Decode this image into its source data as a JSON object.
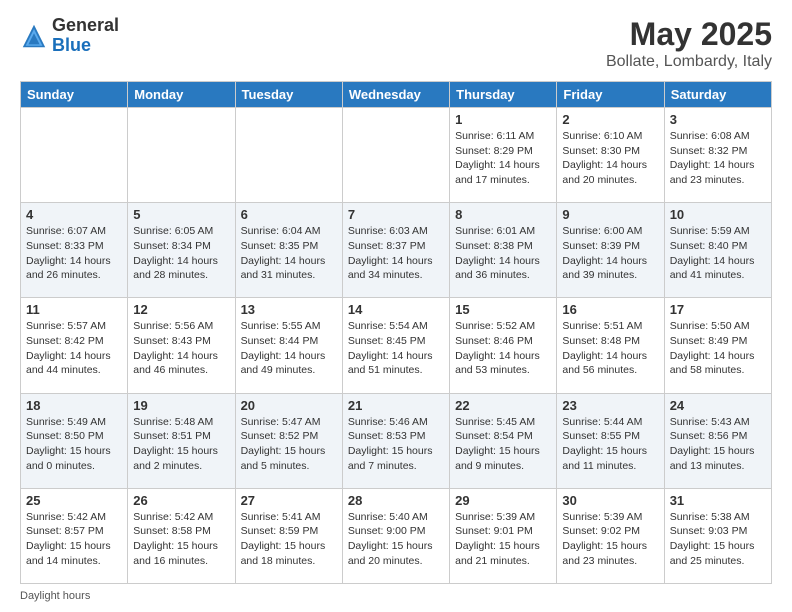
{
  "header": {
    "logo_general": "General",
    "logo_blue": "Blue",
    "month": "May 2025",
    "location": "Bollate, Lombardy, Italy"
  },
  "days_of_week": [
    "Sunday",
    "Monday",
    "Tuesday",
    "Wednesday",
    "Thursday",
    "Friday",
    "Saturday"
  ],
  "weeks": [
    [
      {
        "num": "",
        "info": ""
      },
      {
        "num": "",
        "info": ""
      },
      {
        "num": "",
        "info": ""
      },
      {
        "num": "",
        "info": ""
      },
      {
        "num": "1",
        "info": "Sunrise: 6:11 AM\nSunset: 8:29 PM\nDaylight: 14 hours and 17 minutes."
      },
      {
        "num": "2",
        "info": "Sunrise: 6:10 AM\nSunset: 8:30 PM\nDaylight: 14 hours and 20 minutes."
      },
      {
        "num": "3",
        "info": "Sunrise: 6:08 AM\nSunset: 8:32 PM\nDaylight: 14 hours and 23 minutes."
      }
    ],
    [
      {
        "num": "4",
        "info": "Sunrise: 6:07 AM\nSunset: 8:33 PM\nDaylight: 14 hours and 26 minutes."
      },
      {
        "num": "5",
        "info": "Sunrise: 6:05 AM\nSunset: 8:34 PM\nDaylight: 14 hours and 28 minutes."
      },
      {
        "num": "6",
        "info": "Sunrise: 6:04 AM\nSunset: 8:35 PM\nDaylight: 14 hours and 31 minutes."
      },
      {
        "num": "7",
        "info": "Sunrise: 6:03 AM\nSunset: 8:37 PM\nDaylight: 14 hours and 34 minutes."
      },
      {
        "num": "8",
        "info": "Sunrise: 6:01 AM\nSunset: 8:38 PM\nDaylight: 14 hours and 36 minutes."
      },
      {
        "num": "9",
        "info": "Sunrise: 6:00 AM\nSunset: 8:39 PM\nDaylight: 14 hours and 39 minutes."
      },
      {
        "num": "10",
        "info": "Sunrise: 5:59 AM\nSunset: 8:40 PM\nDaylight: 14 hours and 41 minutes."
      }
    ],
    [
      {
        "num": "11",
        "info": "Sunrise: 5:57 AM\nSunset: 8:42 PM\nDaylight: 14 hours and 44 minutes."
      },
      {
        "num": "12",
        "info": "Sunrise: 5:56 AM\nSunset: 8:43 PM\nDaylight: 14 hours and 46 minutes."
      },
      {
        "num": "13",
        "info": "Sunrise: 5:55 AM\nSunset: 8:44 PM\nDaylight: 14 hours and 49 minutes."
      },
      {
        "num": "14",
        "info": "Sunrise: 5:54 AM\nSunset: 8:45 PM\nDaylight: 14 hours and 51 minutes."
      },
      {
        "num": "15",
        "info": "Sunrise: 5:52 AM\nSunset: 8:46 PM\nDaylight: 14 hours and 53 minutes."
      },
      {
        "num": "16",
        "info": "Sunrise: 5:51 AM\nSunset: 8:48 PM\nDaylight: 14 hours and 56 minutes."
      },
      {
        "num": "17",
        "info": "Sunrise: 5:50 AM\nSunset: 8:49 PM\nDaylight: 14 hours and 58 minutes."
      }
    ],
    [
      {
        "num": "18",
        "info": "Sunrise: 5:49 AM\nSunset: 8:50 PM\nDaylight: 15 hours and 0 minutes."
      },
      {
        "num": "19",
        "info": "Sunrise: 5:48 AM\nSunset: 8:51 PM\nDaylight: 15 hours and 2 minutes."
      },
      {
        "num": "20",
        "info": "Sunrise: 5:47 AM\nSunset: 8:52 PM\nDaylight: 15 hours and 5 minutes."
      },
      {
        "num": "21",
        "info": "Sunrise: 5:46 AM\nSunset: 8:53 PM\nDaylight: 15 hours and 7 minutes."
      },
      {
        "num": "22",
        "info": "Sunrise: 5:45 AM\nSunset: 8:54 PM\nDaylight: 15 hours and 9 minutes."
      },
      {
        "num": "23",
        "info": "Sunrise: 5:44 AM\nSunset: 8:55 PM\nDaylight: 15 hours and 11 minutes."
      },
      {
        "num": "24",
        "info": "Sunrise: 5:43 AM\nSunset: 8:56 PM\nDaylight: 15 hours and 13 minutes."
      }
    ],
    [
      {
        "num": "25",
        "info": "Sunrise: 5:42 AM\nSunset: 8:57 PM\nDaylight: 15 hours and 14 minutes."
      },
      {
        "num": "26",
        "info": "Sunrise: 5:42 AM\nSunset: 8:58 PM\nDaylight: 15 hours and 16 minutes."
      },
      {
        "num": "27",
        "info": "Sunrise: 5:41 AM\nSunset: 8:59 PM\nDaylight: 15 hours and 18 minutes."
      },
      {
        "num": "28",
        "info": "Sunrise: 5:40 AM\nSunset: 9:00 PM\nDaylight: 15 hours and 20 minutes."
      },
      {
        "num": "29",
        "info": "Sunrise: 5:39 AM\nSunset: 9:01 PM\nDaylight: 15 hours and 21 minutes."
      },
      {
        "num": "30",
        "info": "Sunrise: 5:39 AM\nSunset: 9:02 PM\nDaylight: 15 hours and 23 minutes."
      },
      {
        "num": "31",
        "info": "Sunrise: 5:38 AM\nSunset: 9:03 PM\nDaylight: 15 hours and 25 minutes."
      }
    ]
  ],
  "footer": {
    "daylight_label": "Daylight hours"
  }
}
